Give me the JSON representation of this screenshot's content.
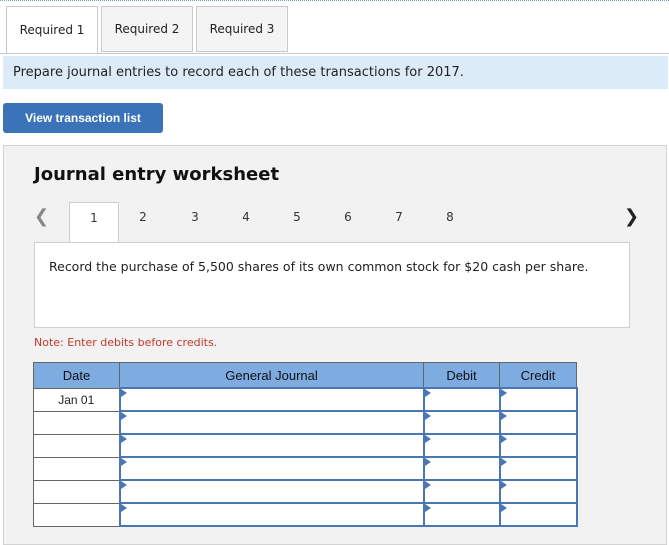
{
  "tabs": [
    {
      "label": "Required 1",
      "active": true
    },
    {
      "label": "Required 2",
      "active": false
    },
    {
      "label": "Required 3",
      "active": false
    }
  ],
  "banner": {
    "text": "Prepare journal entries to record each of these transactions for 2017."
  },
  "view_button": {
    "label": "View transaction list"
  },
  "worksheet": {
    "title": "Journal entry worksheet",
    "pages": [
      "1",
      "2",
      "3",
      "4",
      "5",
      "6",
      "7",
      "8"
    ],
    "active_page": "1",
    "prev_icon": "chevron-left-icon",
    "next_icon": "chevron-right-icon",
    "description": "Record the purchase of 5,500 shares of its own common stock for $20 cash per share.",
    "note": "Note: Enter debits before credits.",
    "table": {
      "headers": {
        "date": "Date",
        "journal": "General Journal",
        "debit": "Debit",
        "credit": "Credit"
      },
      "rows": [
        {
          "date": "Jan 01"
        },
        {
          "date": ""
        },
        {
          "date": ""
        },
        {
          "date": ""
        },
        {
          "date": ""
        },
        {
          "date": ""
        }
      ]
    }
  },
  "colors": {
    "accent": "#3b73b9",
    "banner": "#dcebf8",
    "header": "#7eabe0",
    "note": "#c0392b"
  }
}
